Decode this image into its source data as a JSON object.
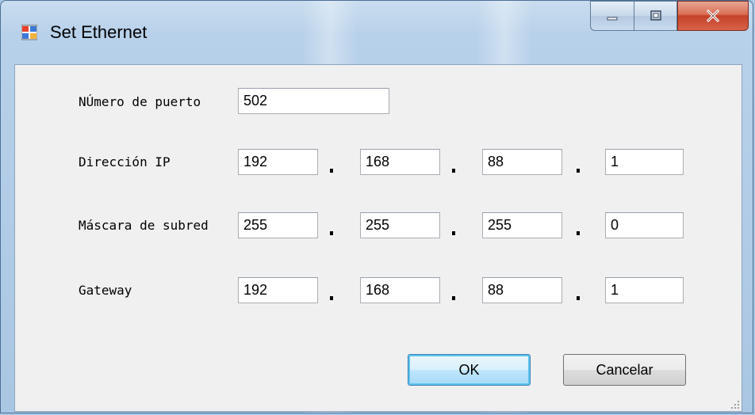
{
  "window": {
    "title": "Set Ethernet",
    "icon": "app-window-icon",
    "controls": {
      "minimize": "minimize-icon",
      "maximize": "maximize-icon",
      "close": "close-icon"
    }
  },
  "form": {
    "port": {
      "label": "NÚmero de puerto",
      "value": "502"
    },
    "ip": {
      "label": "Dirección IP",
      "octets": [
        "192",
        "168",
        "88",
        "1"
      ]
    },
    "mask": {
      "label": "Máscara de subred",
      "octets": [
        "255",
        "255",
        "255",
        "0"
      ]
    },
    "gateway": {
      "label": "Gateway",
      "octets": [
        "192",
        "168",
        "88",
        "1"
      ]
    }
  },
  "buttons": {
    "ok": "OK",
    "cancel": "Cancelar"
  },
  "colors": {
    "window_frame": "#a9c6e2",
    "client_bg": "#f0f0f0",
    "close_button": "#c4412a",
    "ok_focus": "#5ec4ef"
  }
}
